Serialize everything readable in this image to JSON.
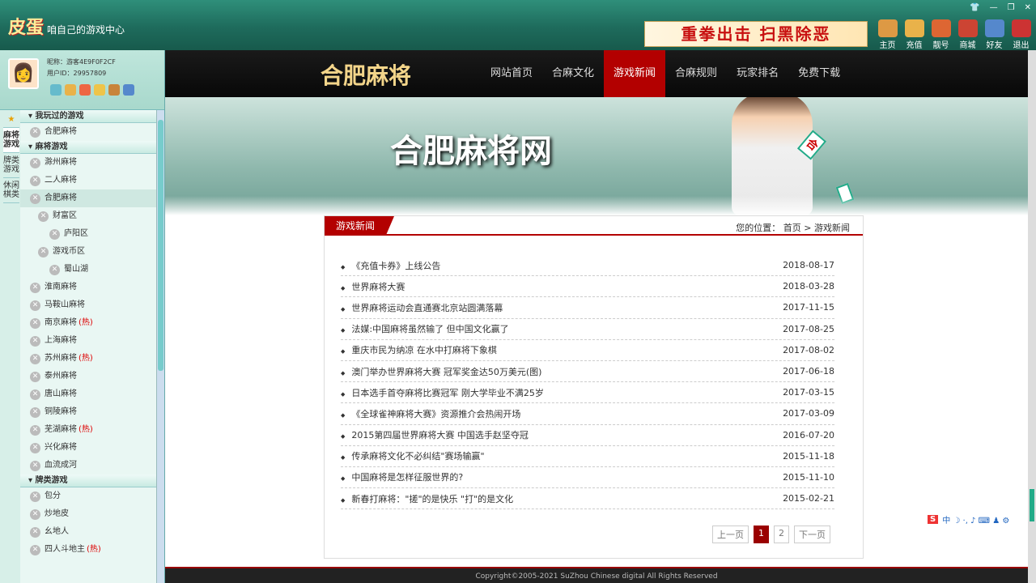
{
  "app": {
    "logo_main": "皮蛋",
    "logo_sub": "咱自己的游戏中心"
  },
  "ad": {
    "text": "重拳出击 扫黑除恶"
  },
  "topnav": [
    {
      "label": "主页",
      "icon": "home-icon"
    },
    {
      "label": "充值",
      "icon": "coins-icon"
    },
    {
      "label": "靓号",
      "icon": "badge-icon"
    },
    {
      "label": "商城",
      "icon": "shop-icon"
    },
    {
      "label": "好友",
      "icon": "friends-icon"
    },
    {
      "label": "退出",
      "icon": "power-icon"
    }
  ],
  "user": {
    "nickname_label": "昵称：",
    "nickname": "游客4E9F0F2CF",
    "id_label": "用户ID：",
    "id": "29957809"
  },
  "sidetabs": [
    "麻将游戏",
    "牌类游戏",
    "休闲棋类"
  ],
  "tree": {
    "g1": "我玩过的游戏",
    "g1_items": [
      "合肥麻将"
    ],
    "g2": "麻将游戏",
    "g2_items": [
      "滁州麻将",
      "二人麻将",
      "合肥麻将"
    ],
    "sub1": "财富区",
    "sub1_item": "庐阳区",
    "sub2": "游戏币区",
    "sub2_item": "蜀山湖",
    "g2_rest": [
      {
        "n": "淮南麻将",
        "hot": ""
      },
      {
        "n": "马鞍山麻将",
        "hot": ""
      },
      {
        "n": "南京麻将",
        "hot": "(热)"
      },
      {
        "n": "上海麻将",
        "hot": ""
      },
      {
        "n": "苏州麻将",
        "hot": "(热)"
      },
      {
        "n": "泰州麻将",
        "hot": ""
      },
      {
        "n": "唐山麻将",
        "hot": ""
      },
      {
        "n": "铜陵麻将",
        "hot": ""
      },
      {
        "n": "芜湖麻将",
        "hot": "(热)"
      },
      {
        "n": "兴化麻将",
        "hot": ""
      },
      {
        "n": "血流成河",
        "hot": ""
      }
    ],
    "g3": "牌类游戏",
    "g3_items": [
      {
        "n": "包分",
        "hot": ""
      },
      {
        "n": "炒地皮",
        "hot": ""
      },
      {
        "n": "幺地人",
        "hot": ""
      },
      {
        "n": "四人斗地主",
        "hot": "(热)"
      }
    ]
  },
  "site": {
    "logo": "合肥麻将",
    "menu": [
      "网站首页",
      "合麻文化",
      "游戏新闻",
      "合麻规则",
      "玩家排名",
      "免费下载"
    ],
    "hero_title": "合肥麻将网",
    "tile_char": "合"
  },
  "panel": {
    "tab": "游戏新闻",
    "crumb": "您的位置：  首页 > 游戏新闻"
  },
  "news": [
    {
      "t": "《充值卡券》上线公告",
      "d": "2018-08-17"
    },
    {
      "t": "世界麻将大赛",
      "d": "2018-03-28"
    },
    {
      "t": "世界麻将运动会直通赛北京站圆满落幕",
      "d": "2017-11-15"
    },
    {
      "t": "法媒:中国麻将虽然输了 但中国文化赢了",
      "d": "2017-08-25"
    },
    {
      "t": "重庆市民为纳凉 在水中打麻将下象棋",
      "d": "2017-08-02"
    },
    {
      "t": "澳门举办世界麻将大赛 冠军奖金达50万美元(图)",
      "d": "2017-06-18"
    },
    {
      "t": "日本选手首夺麻将比赛冠军 刚大学毕业不满25岁",
      "d": "2017-03-15"
    },
    {
      "t": "《全球雀神麻将大赛》资源推介会热闹开场",
      "d": "2017-03-09"
    },
    {
      "t": "2015第四届世界麻将大赛 中国选手赵坚夺冠",
      "d": "2016-07-20"
    },
    {
      "t": "传承麻将文化不必纠结\"赛场输赢\"",
      "d": "2015-11-18"
    },
    {
      "t": "中国麻将是怎样征服世界的?",
      "d": "2015-11-10"
    },
    {
      "t": "新春打麻将：\"搓\"的是快乐 \"打\"的是文化",
      "d": "2015-02-21"
    }
  ],
  "pager": {
    "prev": "上一页",
    "p1": "1",
    "p2": "2",
    "next": "下一页"
  },
  "footer": "Copyright©2005-2021 SuZhou Chinese digital All Rights Reserved",
  "ime": {
    "s": "S",
    "items": "中 ☽ ·, ♪ ⌨ ♟ ⚙"
  }
}
